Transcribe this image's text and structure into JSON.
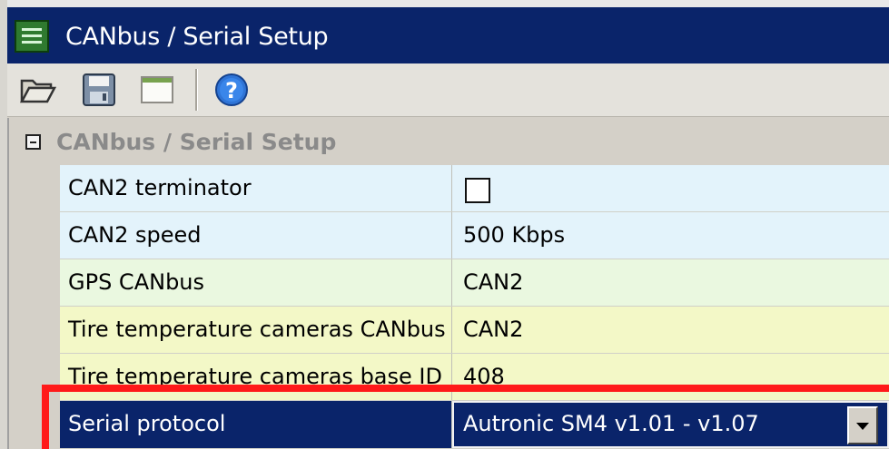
{
  "window": {
    "title": "CANbus / Serial Setup"
  },
  "toolbar": {
    "buttons": [
      {
        "name": "open",
        "icon": "folder-open-icon"
      },
      {
        "name": "save",
        "icon": "floppy-disk-icon"
      },
      {
        "name": "window",
        "icon": "window-icon"
      },
      {
        "name": "help",
        "icon": "help-icon"
      }
    ]
  },
  "grid": {
    "category": "CANbus / Serial Setup",
    "rows": [
      {
        "name": "CAN2 terminator",
        "value": "",
        "type": "checkbox",
        "checked": false
      },
      {
        "name": "CAN2 speed",
        "value": "500 Kbps"
      },
      {
        "name": "GPS CANbus",
        "value": "CAN2"
      },
      {
        "name": "Tire temperature cameras CANbus",
        "value": "CAN2"
      },
      {
        "name": "Tire temperature cameras base ID",
        "value": "408"
      },
      {
        "name": "Serial protocol",
        "value": "Autronic SM4 v1.01 - v1.07",
        "type": "dropdown",
        "selected": true
      }
    ]
  },
  "colors": {
    "titlebar": "#0a246a",
    "row_blue": "#e3f3fb",
    "row_green": "#eaf8e0",
    "row_yellow": "#f3f8c7",
    "selection": "#0a246a",
    "highlight": "#ff1a1a"
  }
}
